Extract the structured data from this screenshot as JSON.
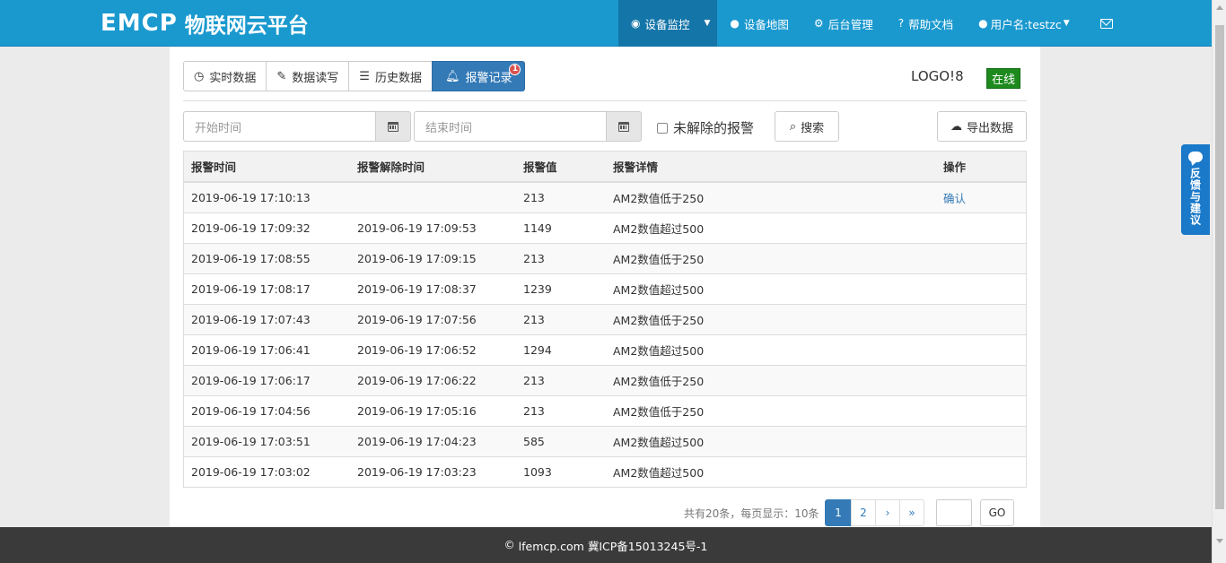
{
  "brand": {
    "logo": "EMCP",
    "name": "物联网云平台"
  },
  "nav": [
    {
      "label": "设备监控",
      "icon": "monitor-icon"
    },
    {
      "label": "设备地图",
      "icon": "globe-icon"
    },
    {
      "label": "后台管理",
      "icon": "gears-icon"
    },
    {
      "label": "帮助文档",
      "icon": "question-icon"
    },
    {
      "label": "用户名:testzc",
      "icon": "user-icon"
    }
  ],
  "tabs": [
    {
      "label": "实时数据",
      "icon": "clock-icon"
    },
    {
      "label": "数据读写",
      "icon": "pencil-icon"
    },
    {
      "label": "历史数据",
      "icon": "list-icon"
    },
    {
      "label": "报警记录",
      "icon": "bell-icon",
      "badge": "1"
    }
  ],
  "device": {
    "name": "LOGO!8",
    "status": "在线"
  },
  "search": {
    "start_placeholder": "开始时间",
    "end_placeholder": "结束时间",
    "unresolved_label": "未解除的报警",
    "search_label": "搜索",
    "export_label": "导出数据"
  },
  "table": {
    "headers": [
      "报警时间",
      "报警解除时间",
      "报警值",
      "报警详情",
      "操作"
    ],
    "rows": [
      [
        "2019-06-19 17:10:13",
        "",
        "213",
        "AM2数值低于250",
        "确认"
      ],
      [
        "2019-06-19 17:09:32",
        "2019-06-19 17:09:53",
        "1149",
        "AM2数值超过500",
        ""
      ],
      [
        "2019-06-19 17:08:55",
        "2019-06-19 17:09:15",
        "213",
        "AM2数值低于250",
        ""
      ],
      [
        "2019-06-19 17:08:17",
        "2019-06-19 17:08:37",
        "1239",
        "AM2数值超过500",
        ""
      ],
      [
        "2019-06-19 17:07:43",
        "2019-06-19 17:07:56",
        "213",
        "AM2数值低于250",
        ""
      ],
      [
        "2019-06-19 17:06:41",
        "2019-06-19 17:06:52",
        "1294",
        "AM2数值超过500",
        ""
      ],
      [
        "2019-06-19 17:06:17",
        "2019-06-19 17:06:22",
        "213",
        "AM2数值低于250",
        ""
      ],
      [
        "2019-06-19 17:04:56",
        "2019-06-19 17:05:16",
        "213",
        "AM2数值低于250",
        ""
      ],
      [
        "2019-06-19 17:03:51",
        "2019-06-19 17:04:23",
        "585",
        "AM2数值超过500",
        ""
      ],
      [
        "2019-06-19 17:03:02",
        "2019-06-19 17:03:23",
        "1093",
        "AM2数值超过500",
        ""
      ]
    ]
  },
  "pagination": {
    "info": "共有20条，每页显示：10条",
    "pages": [
      "1",
      "2",
      "›",
      "»"
    ],
    "current": "1",
    "go_label": "GO"
  },
  "footer": {
    "text": "lfemcp.com 冀ICP备15013245号-1"
  },
  "feedback": {
    "label": "反馈与建议"
  },
  "colors": {
    "navbar": "#1a99cf",
    "primary": "#337ab7",
    "online": "#1d8a1d",
    "footer": "#3a3a3a"
  }
}
